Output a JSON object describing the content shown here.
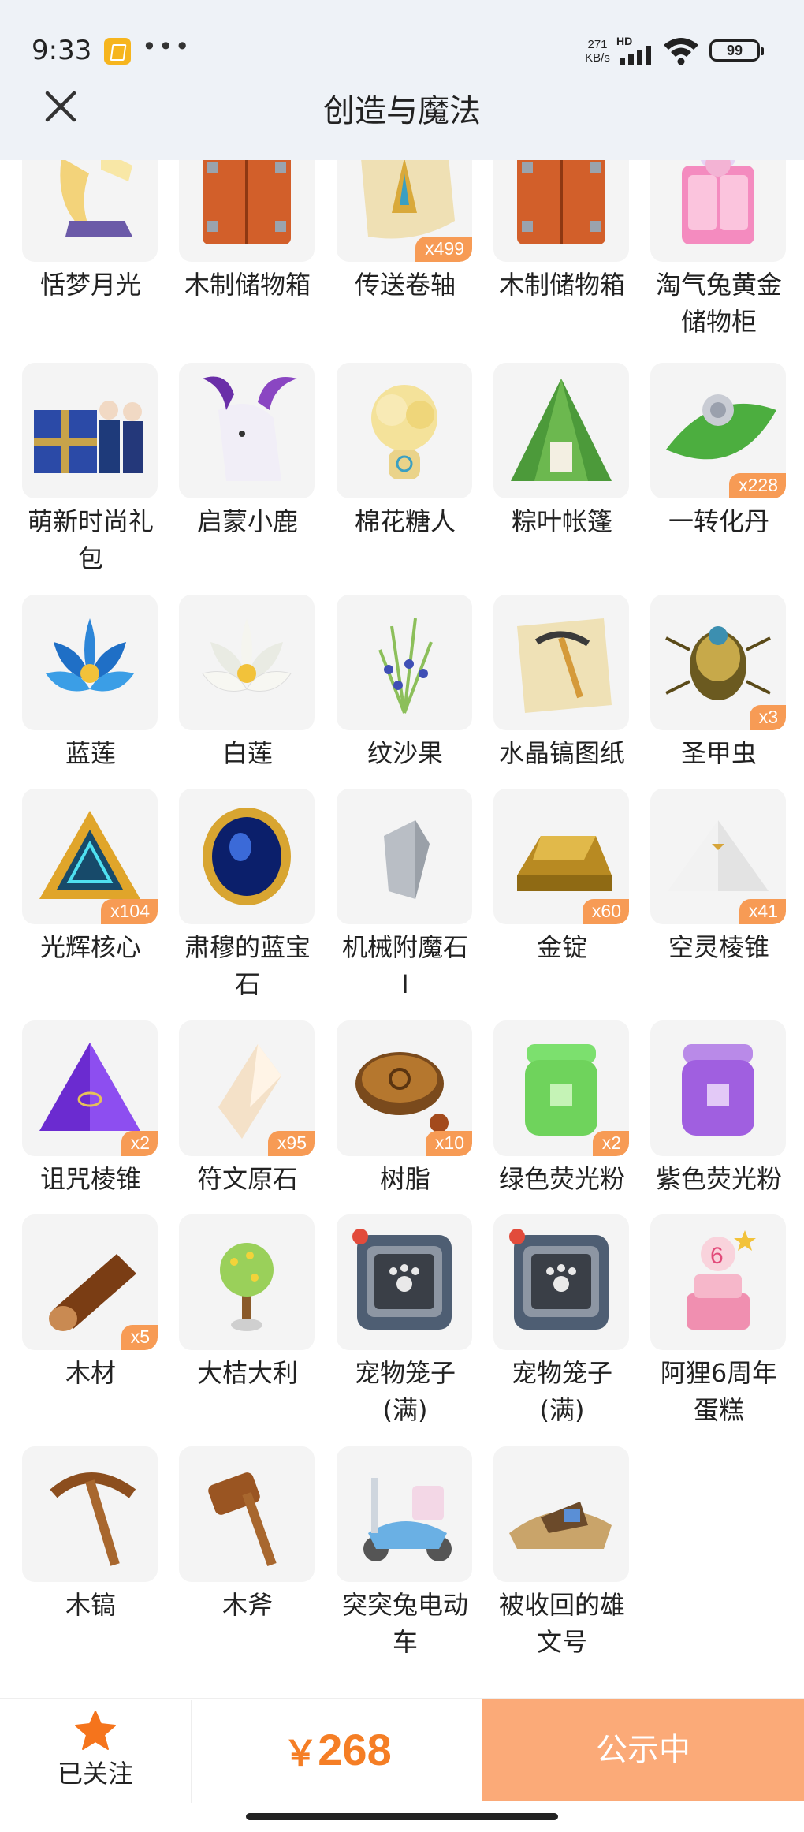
{
  "status_bar": {
    "time": "9:33",
    "dots": "•••",
    "net_speed_value": "271",
    "net_speed_unit": "KB/s",
    "network": "HD",
    "battery": "99"
  },
  "header": {
    "title": "创造与魔法",
    "close_icon": "close-icon"
  },
  "items": [
    {
      "label": "恬梦月光",
      "icon": "crescent-moon-bed",
      "badge": ""
    },
    {
      "label": "木制储物箱",
      "icon": "wooden-chest",
      "badge": ""
    },
    {
      "label": "传送卷轴",
      "icon": "teleport-scroll",
      "badge": "x499"
    },
    {
      "label": "木制储物箱",
      "icon": "wooden-chest",
      "badge": ""
    },
    {
      "label": "淘气兔黄金储物柜",
      "icon": "pink-bunny-cabinet",
      "badge": ""
    },
    {
      "label": "萌新时尚礼包",
      "icon": "gift-box-with-figures",
      "badge": ""
    },
    {
      "label": "启蒙小鹿",
      "icon": "white-deer",
      "badge": ""
    },
    {
      "label": "棉花糖人",
      "icon": "cotton-candy-figure",
      "badge": ""
    },
    {
      "label": "粽叶帐篷",
      "icon": "leaf-tent",
      "badge": ""
    },
    {
      "label": "一转化丹",
      "icon": "pill-on-leaf",
      "badge": "x228"
    },
    {
      "label": "蓝莲",
      "icon": "blue-lotus",
      "badge": ""
    },
    {
      "label": "白莲",
      "icon": "white-lotus",
      "badge": ""
    },
    {
      "label": "纹沙果",
      "icon": "berry-plant",
      "badge": ""
    },
    {
      "label": "水晶镐图纸",
      "icon": "pickaxe-blueprint",
      "badge": ""
    },
    {
      "label": "圣甲虫",
      "icon": "scarab-beetle",
      "badge": "x3"
    },
    {
      "label": "光辉核心",
      "icon": "glowing-triangle-core",
      "badge": "x104"
    },
    {
      "label": "肃穆的蓝宝石",
      "icon": "blue-sapphire",
      "badge": ""
    },
    {
      "label": "机械附魔石Ⅰ",
      "icon": "grey-stone",
      "badge": ""
    },
    {
      "label": "金锭",
      "icon": "gold-ingot",
      "badge": "x60"
    },
    {
      "label": "空灵棱锥",
      "icon": "white-pyramid",
      "badge": "x41"
    },
    {
      "label": "诅咒棱锥",
      "icon": "purple-pyramid",
      "badge": "x2"
    },
    {
      "label": "符文原石",
      "icon": "rune-crystal",
      "badge": "x95"
    },
    {
      "label": "树脂",
      "icon": "resin-stump",
      "badge": "x10"
    },
    {
      "label": "绿色荧光粉",
      "icon": "green-powder-jar",
      "badge": "x2"
    },
    {
      "label": "紫色荧光粉",
      "icon": "purple-powder-jar",
      "badge": ""
    },
    {
      "label": "木材",
      "icon": "wood-log",
      "badge": "x5"
    },
    {
      "label": "大桔大利",
      "icon": "orange-tree",
      "badge": ""
    },
    {
      "label": "宠物笼子(满)",
      "icon": "pet-cage",
      "badge": ""
    },
    {
      "label": "宠物笼子(满)",
      "icon": "pet-cage",
      "badge": ""
    },
    {
      "label": "阿狸6周年蛋糕",
      "icon": "anniversary-cake",
      "badge": ""
    },
    {
      "label": "木镐",
      "icon": "wooden-pickaxe",
      "badge": ""
    },
    {
      "label": "木斧",
      "icon": "wooden-axe",
      "badge": ""
    },
    {
      "label": "突突兔电动车",
      "icon": "blue-scooter",
      "badge": ""
    },
    {
      "label": "被收回的雄文号",
      "icon": "shipwreck",
      "badge": ""
    }
  ],
  "footer": {
    "follow_label": "已关注",
    "follow_icon": "star-icon",
    "price_currency": "￥",
    "price_value": "268",
    "cta_label": "公示中"
  },
  "colors": {
    "accent": "#f57e25",
    "cta_bg": "#fbaa78",
    "badge_bg": "#f79b55",
    "header_bg": "#eef2f7"
  }
}
